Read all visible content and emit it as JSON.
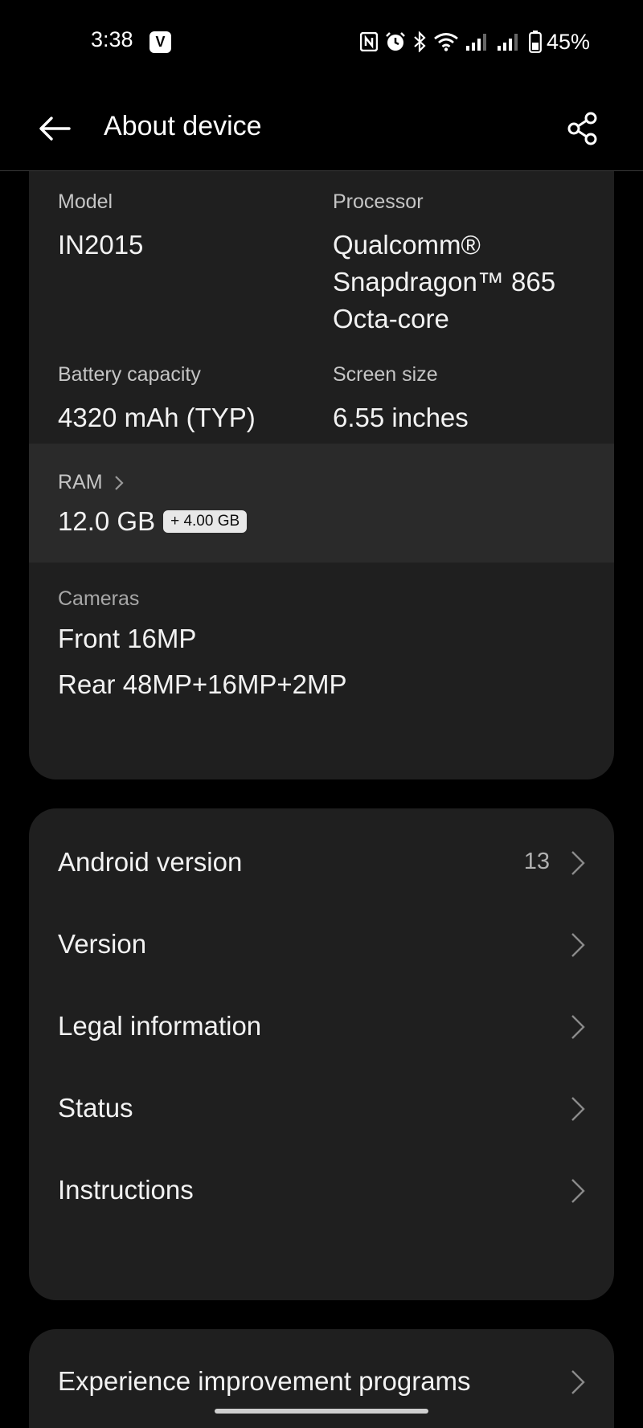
{
  "status_bar": {
    "time": "3:38",
    "notification_icon": "V",
    "battery_percent": "45%",
    "icons": [
      "nfc-icon",
      "alarm-icon",
      "bluetooth-icon",
      "wifi-icon",
      "signal-1-icon",
      "signal-2-icon",
      "battery-icon"
    ]
  },
  "header": {
    "title": "About device",
    "back_icon": "back-arrow-icon",
    "share_icon": "share-icon"
  },
  "specs": {
    "model_label": "Model",
    "model_value": "IN2015",
    "processor_label": "Processor",
    "processor_value": [
      "Qualcomm®",
      "Snapdragon™ 865",
      "Octa-core"
    ],
    "battery_label": "Battery capacity",
    "battery_value": "4320 mAh (TYP)",
    "screen_label": "Screen size",
    "screen_value": "6.55 inches",
    "ram_label": "RAM",
    "ram_value": "12.0 GB",
    "ram_extension": "+ 4.00 GB",
    "cameras_label": "Cameras",
    "cameras_front": "Front 16MP",
    "cameras_rear": "Rear 48MP+16MP+2MP"
  },
  "menu": [
    {
      "label": "Android version",
      "value": "13"
    },
    {
      "label": "Version",
      "value": ""
    },
    {
      "label": "Legal information",
      "value": ""
    },
    {
      "label": "Status",
      "value": ""
    },
    {
      "label": "Instructions",
      "value": ""
    }
  ],
  "bottom_menu": [
    {
      "label": "Experience improvement programs"
    }
  ],
  "colors": {
    "background": "#000000",
    "card": "#1f1f1f",
    "highlight_row": "#2a2a2a",
    "text_primary": "#f2f2f2",
    "text_secondary": "#c5c5c5"
  }
}
